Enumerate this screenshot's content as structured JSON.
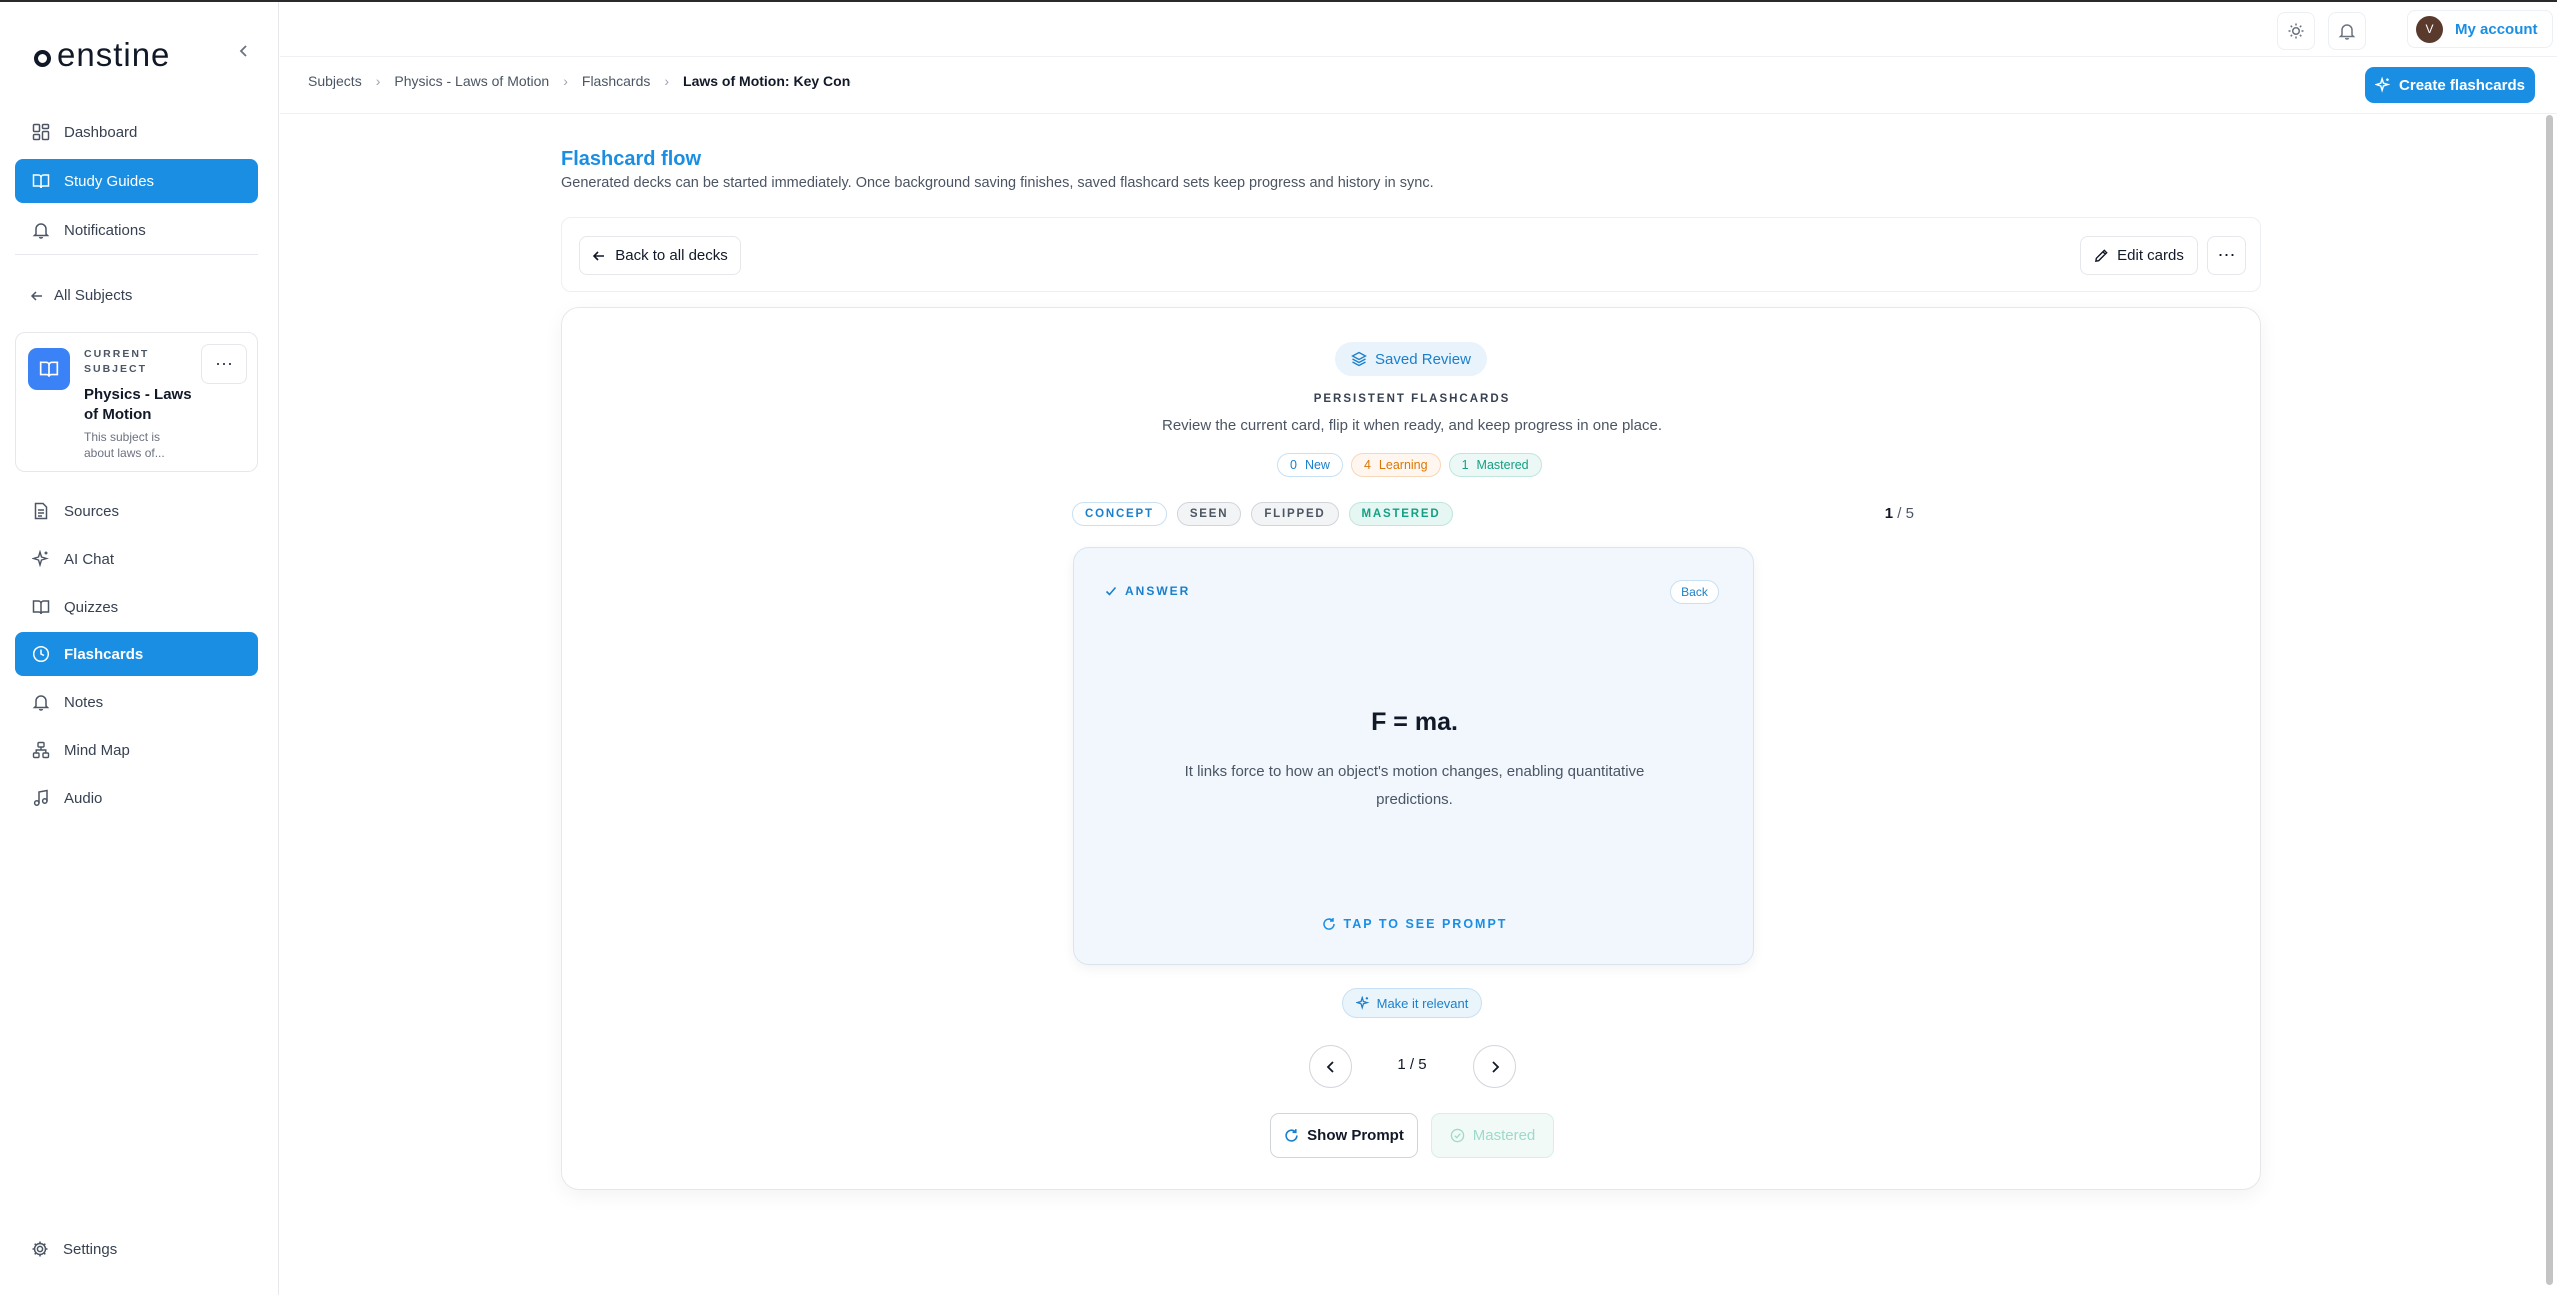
{
  "app": {
    "logo": "enstine"
  },
  "sidebar": {
    "nav_top": [
      {
        "label": "Dashboard",
        "icon": "dashboard-icon"
      },
      {
        "label": "Study Guides",
        "icon": "book-open-icon",
        "active": true
      },
      {
        "label": "Notifications",
        "icon": "bell-icon"
      }
    ],
    "all_subjects": "All Subjects",
    "current_subject": {
      "label": "CURRENT SUBJECT",
      "name": "Physics - Laws of Motion",
      "description": "This subject is about laws of..."
    },
    "nav_bottom": [
      {
        "label": "Sources",
        "icon": "file-icon"
      },
      {
        "label": "AI Chat",
        "icon": "sparkles-icon"
      },
      {
        "label": "Quizzes",
        "icon": "book-icon"
      },
      {
        "label": "Flashcards",
        "icon": "clock-icon",
        "active": true
      },
      {
        "label": "Notes",
        "icon": "bell-icon"
      },
      {
        "label": "Mind Map",
        "icon": "mind-map-icon"
      },
      {
        "label": "Audio",
        "icon": "music-icon"
      }
    ],
    "settings": "Settings"
  },
  "topbar": {
    "account_initial": "V",
    "account_label": "My account"
  },
  "breadcrumb": [
    "Subjects",
    "Physics - Laws of Motion",
    "Flashcards",
    "Laws of Motion: Key Conce"
  ],
  "create_button": "Create flashcards",
  "flow": {
    "title": "Flashcard flow",
    "description": "Generated decks can be started immediately. Once background saving finishes, saved flashcard sets keep progress and history in sync."
  },
  "toolbar": {
    "back": "Back to all decks",
    "edit": "Edit cards"
  },
  "review": {
    "pill": "Saved Review",
    "heading": "PERSISTENT FLASHCARDS",
    "subtitle": "Review the current card, flip it when ready, and keep progress in one place.",
    "counts": {
      "new_n": "0",
      "new_label": "New",
      "learning_n": "4",
      "learning_label": "Learning",
      "mastered_n": "1",
      "mastered_label": "Mastered"
    },
    "tags": [
      "CONCEPT",
      "SEEN",
      "FLIPPED",
      "MASTERED"
    ],
    "counter_current": "1",
    "counter_total": " / 5"
  },
  "card": {
    "side_label": "ANSWER",
    "back_pill": "Back",
    "answer": "F = ma.",
    "explanation": "It links force to how an object's motion changes, enabling quantitative predictions.",
    "tap_hint": "TAP TO SEE PROMPT"
  },
  "controls": {
    "relevant": "Make it relevant",
    "page": "1 / 5",
    "show_prompt": "Show Prompt",
    "mastered": "Mastered"
  },
  "colors": {
    "accent": "#1a8ee3",
    "mastered": "#14a085",
    "learning": "#d97706"
  }
}
